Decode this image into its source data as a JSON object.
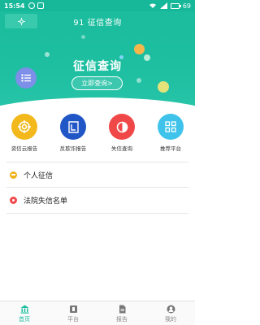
{
  "status_bar": {
    "time": "15:54",
    "battery": "69"
  },
  "header": {
    "title": "91 征信查询",
    "menu_icon": "compass-icon"
  },
  "banner": {
    "title": "征信查询",
    "button_label": "立即查询>"
  },
  "grid": [
    {
      "label": "资信云报告",
      "color": "#f2b81c",
      "icon": "target-icon"
    },
    {
      "label": "反欺诈报告",
      "color": "#2156c6",
      "icon": "document-frame-icon"
    },
    {
      "label": "失信查询",
      "color": "#f04848",
      "icon": "half-circle-icon"
    },
    {
      "label": "推荐平台",
      "color": "#3fc3ea",
      "icon": "grid-squares-icon"
    }
  ],
  "list": [
    {
      "label": "个人征信",
      "color": "#f0b21b"
    },
    {
      "label": "法院失信名单",
      "color": "#f04848"
    }
  ],
  "tabs": [
    {
      "label": "首页",
      "icon": "bank-icon",
      "active": true
    },
    {
      "label": "平台",
      "icon": "platform-icon",
      "active": false
    },
    {
      "label": "报告",
      "icon": "report-icon",
      "active": false
    },
    {
      "label": "我的",
      "icon": "user-icon",
      "active": false
    }
  ],
  "colors": {
    "primary": "#1bbd9e",
    "inactive": "#888888"
  }
}
